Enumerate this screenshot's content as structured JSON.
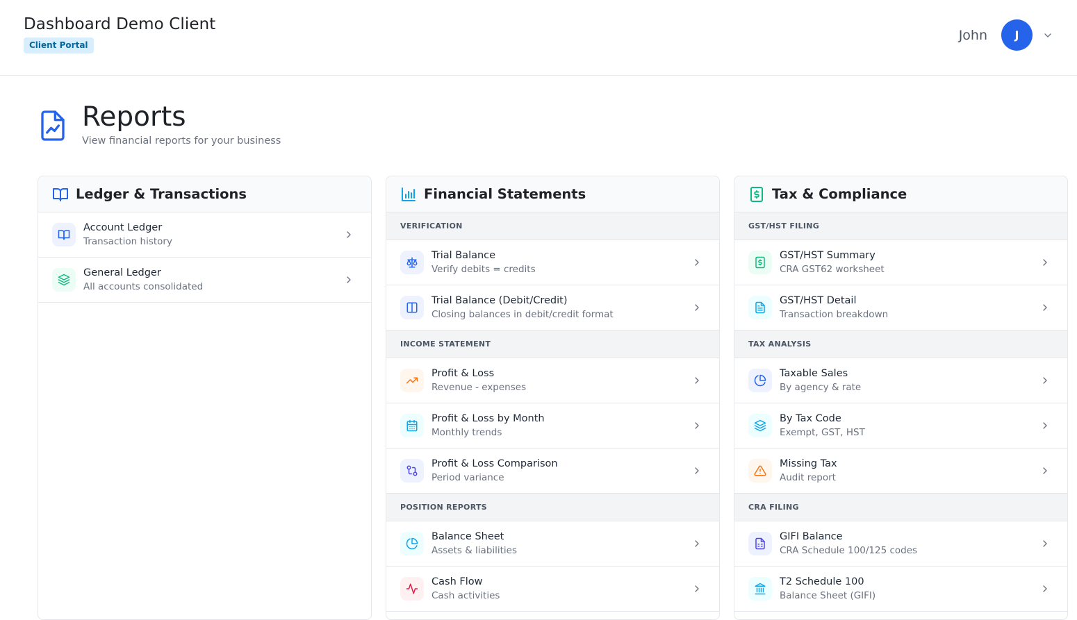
{
  "header": {
    "title": "Dashboard Demo Client",
    "badge": "Client Portal",
    "user_name": "John",
    "avatar_initial": "J"
  },
  "page": {
    "title": "Reports",
    "subtitle": "View financial reports for your business"
  },
  "colors": {
    "accent": "#2563eb",
    "badge_bg": "#d8eefc",
    "badge_text": "#0369a1"
  },
  "ledger": {
    "title": "Ledger & Transactions",
    "icon": "book-open-icon",
    "items": [
      {
        "title": "Account Ledger",
        "sub": "Transaction history",
        "icon": "book-icon"
      },
      {
        "title": "General Ledger",
        "sub": "All accounts consolidated",
        "icon": "layers-icon"
      }
    ]
  },
  "financial": {
    "title": "Financial Statements",
    "icon": "bar-chart-icon",
    "sections": [
      {
        "label": "VERIFICATION",
        "items": [
          {
            "title": "Trial Balance",
            "sub": "Verify debits = credits",
            "icon": "scale-icon"
          },
          {
            "title": "Trial Balance (Debit/Credit)",
            "sub": "Closing balances in debit/credit format",
            "icon": "columns-icon"
          }
        ]
      },
      {
        "label": "INCOME STATEMENT",
        "items": [
          {
            "title": "Profit & Loss",
            "sub": "Revenue - expenses",
            "icon": "trending-up-icon"
          },
          {
            "title": "Profit & Loss by Month",
            "sub": "Monthly trends",
            "icon": "calendar-icon"
          },
          {
            "title": "Profit & Loss Comparison",
            "sub": "Period variance",
            "icon": "compare-icon"
          }
        ]
      },
      {
        "label": "POSITION REPORTS",
        "items": [
          {
            "title": "Balance Sheet",
            "sub": "Assets & liabilities",
            "icon": "pie-chart-icon"
          },
          {
            "title": "Cash Flow",
            "sub": "Cash activities",
            "icon": "activity-icon"
          }
        ]
      }
    ]
  },
  "tax": {
    "title": "Tax & Compliance",
    "icon": "dollar-document-icon",
    "sections": [
      {
        "label": "GST/HST FILING",
        "items": [
          {
            "title": "GST/HST Summary",
            "sub": "CRA GST62 worksheet",
            "icon": "dollar-document-icon"
          },
          {
            "title": "GST/HST Detail",
            "sub": "Transaction breakdown",
            "icon": "file-text-icon"
          }
        ]
      },
      {
        "label": "TAX ANALYSIS",
        "items": [
          {
            "title": "Taxable Sales",
            "sub": "By agency & rate",
            "icon": "pie-chart-icon"
          },
          {
            "title": "By Tax Code",
            "sub": "Exempt, GST, HST",
            "icon": "layers-icon"
          },
          {
            "title": "Missing Tax",
            "sub": "Audit report",
            "icon": "alert-triangle-icon"
          }
        ]
      },
      {
        "label": "CRA FILING",
        "items": [
          {
            "title": "GIFI Balance",
            "sub": "CRA Schedule 100/125 codes",
            "icon": "file-spreadsheet-icon"
          },
          {
            "title": "T2 Schedule 100",
            "sub": "Balance Sheet (GIFI)",
            "icon": "landmark-icon"
          }
        ]
      }
    ]
  }
}
